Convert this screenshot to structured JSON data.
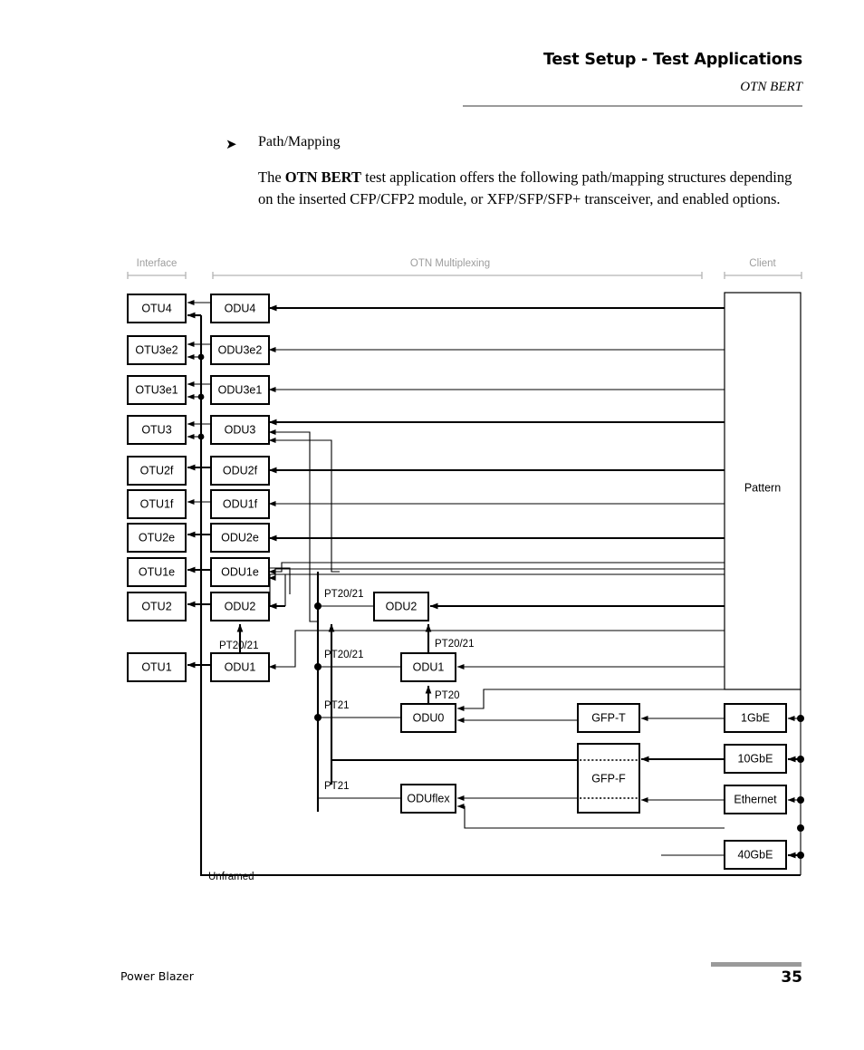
{
  "header": {
    "title": "Test Setup - Test Applications",
    "subtitle": "OTN BERT"
  },
  "content": {
    "bullet_marker": "➤",
    "bullet_label": "Path/Mapping",
    "paragraph_pre": "The ",
    "paragraph_bold": "OTN BERT",
    "paragraph_post": " test application offers the following path/mapping structures depending on the inserted  CFP/CFP2 module, or XFP/SFP/SFP+ transceiver, and enabled options."
  },
  "figure": {
    "scales": [
      {
        "label": "Interface"
      },
      {
        "label": "OTN Multiplexing"
      },
      {
        "label": "Client"
      }
    ],
    "interface_nodes": [
      {
        "label": "OTU4"
      },
      {
        "label": "OTU3e2"
      },
      {
        "label": "OTU3e1"
      },
      {
        "label": "OTU3"
      },
      {
        "label": "OTU2f"
      },
      {
        "label": "OTU1f"
      },
      {
        "label": "OTU2e"
      },
      {
        "label": "OTU1e"
      },
      {
        "label": "OTU2"
      },
      {
        "label": "OTU1"
      }
    ],
    "odu_nodes": [
      {
        "label": "ODU4"
      },
      {
        "label": "ODU3e2"
      },
      {
        "label": "ODU3e1"
      },
      {
        "label": "ODU3"
      },
      {
        "label": "ODU2f"
      },
      {
        "label": "ODU1f"
      },
      {
        "label": "ODU2e"
      },
      {
        "label": "ODU1e"
      },
      {
        "label": "ODU2"
      },
      {
        "label": "ODU1"
      }
    ],
    "mux_nodes": [
      {
        "label": "ODU2"
      },
      {
        "label": "ODU1"
      },
      {
        "label": "ODU0"
      },
      {
        "label": "ODUflex"
      }
    ],
    "gfp_nodes": [
      {
        "label": "GFP-T"
      },
      {
        "label": "GFP-F"
      }
    ],
    "client_nodes": [
      {
        "label": "1GbE"
      },
      {
        "label": "10GbE"
      },
      {
        "label": "Ethernet"
      },
      {
        "label": "40GbE"
      }
    ],
    "pattern_label": "Pattern",
    "unframed_label": "Unframed",
    "pt_labels": {
      "pt2021": "PT20/21",
      "pt20": "PT20",
      "pt21": "PT21"
    },
    "edge_labels": [
      {
        "text": "PT20/21"
      },
      {
        "text": "PT20/21"
      },
      {
        "text": "PT20/21"
      },
      {
        "text": "PT20/21"
      },
      {
        "text": "PT21"
      },
      {
        "text": "PT20"
      },
      {
        "text": "PT21"
      }
    ]
  },
  "footer": {
    "left": "Power Blazer",
    "page": "35"
  },
  "colors": {
    "rule": "#9a9a9a",
    "scale": "#b4b4b4",
    "scale_text": "#9d9d9d",
    "ink": "#000000"
  }
}
